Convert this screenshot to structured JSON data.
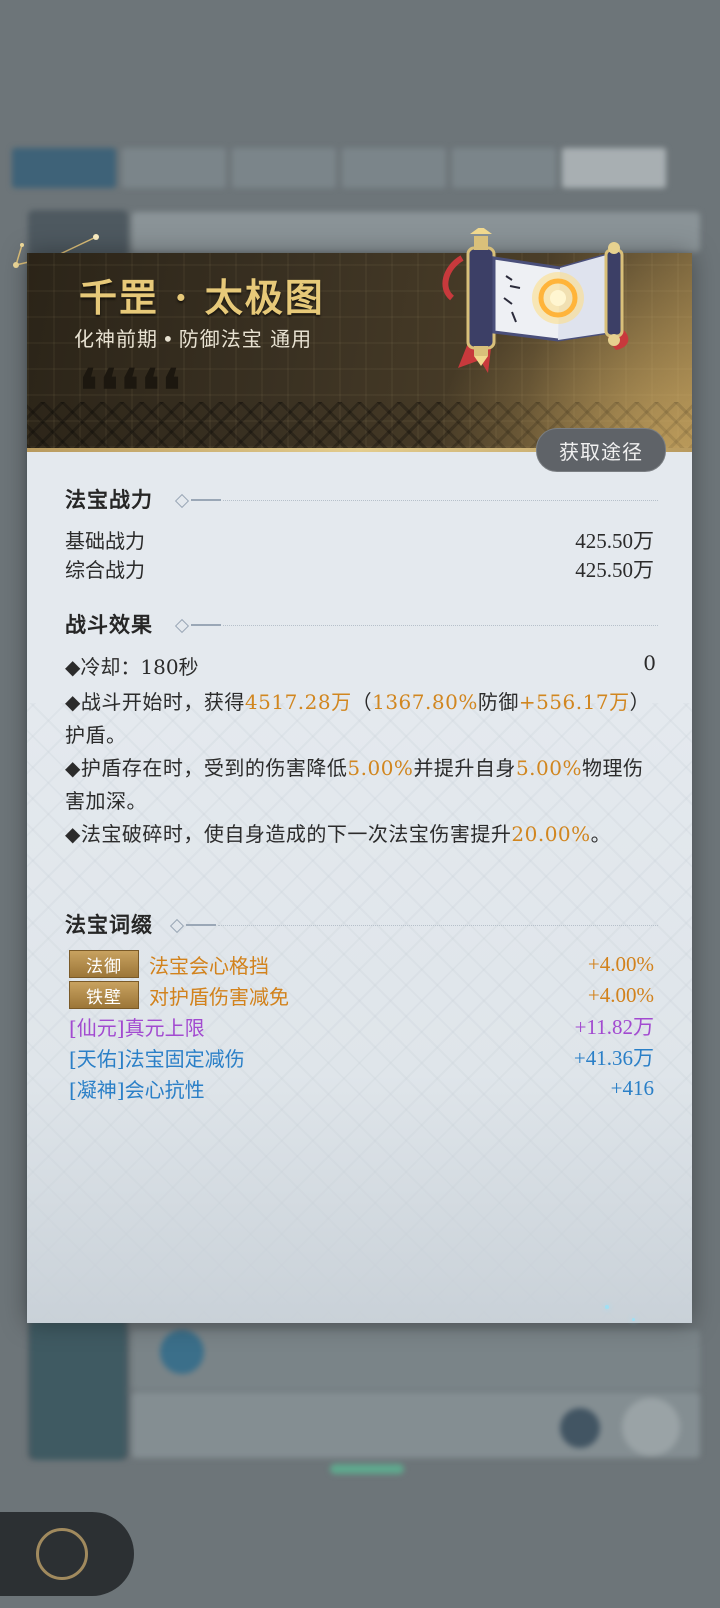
{
  "item": {
    "name": "千罡 · 太极图",
    "realm": "化神前期",
    "type": "防御法宝",
    "usage": "通用",
    "separator": "•"
  },
  "acquire_button": "获取途径",
  "power": {
    "title": "法宝战力",
    "rows": [
      {
        "label": "基础战力",
        "value": "425.50万"
      },
      {
        "label": "综合战力",
        "value": "425.50万"
      }
    ]
  },
  "combat": {
    "title": "战斗效果",
    "cooldown_label": "◆冷却：180秒",
    "cooldown_value": "0",
    "effect1": {
      "p1": "◆战斗开始时，获得",
      "v1": "4517.28万",
      "p2": "（",
      "v2": "1367.80%",
      "p3": "防御",
      "v3": "+556.17万",
      "p4": "）护盾。"
    },
    "effect2": {
      "p1": "◆护盾存在时，受到的伤害降低",
      "v1": "5.00%",
      "p2": "并提升自身",
      "v2": "5.00%",
      "p3": "物理伤害加深。"
    },
    "effect3": {
      "p1": "◆法宝破碎时，使自身造成的下一次法宝伤害提升",
      "v1": "20.00%",
      "p2": "。"
    }
  },
  "affixes": {
    "title": "法宝词缀",
    "items": [
      {
        "tag": "法御",
        "name": "法宝会心格挡",
        "value": "+4.00%"
      },
      {
        "tag": "铁壁",
        "name": "对护盾伤害减免",
        "value": "+4.00%"
      },
      {
        "name": "[仙元]真元上限",
        "value": "+11.82万"
      },
      {
        "name": "[天佑]法宝固定减伤",
        "value": "+41.36万"
      },
      {
        "name": "[凝神]会心抗性",
        "value": "+416"
      }
    ]
  },
  "colors": {
    "title_gold": "#e7c979",
    "highlight_orange": "#d1861f",
    "affix_purple": "#a24ad0",
    "affix_blue": "#2a7fc7"
  },
  "icons": [
    "taiji-scroll-icon",
    "quote-mark-icon",
    "back-button-icon"
  ]
}
